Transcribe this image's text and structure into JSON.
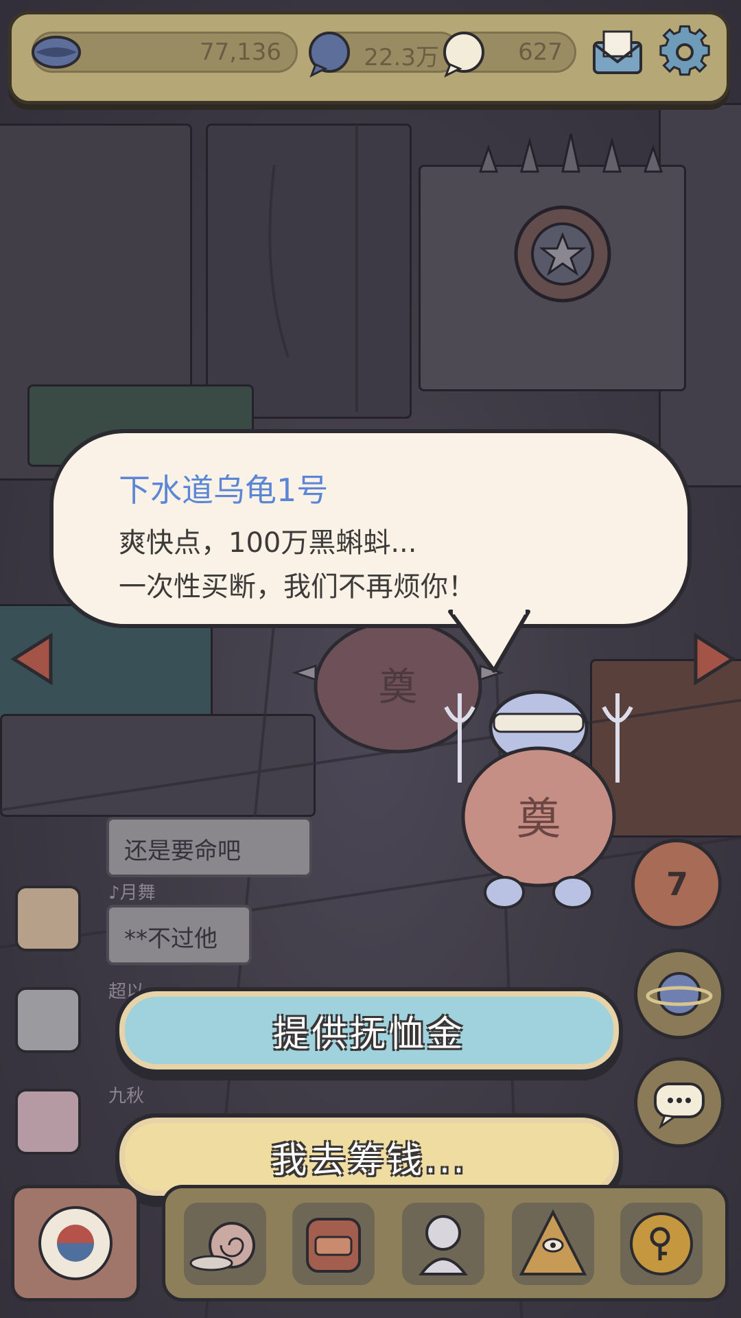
{
  "resources": {
    "coins": "77,136",
    "bubbles": "22.3万",
    "messages": "627"
  },
  "dialog": {
    "speaker": "下水道乌龟1号",
    "line1": "爽快点，100万黑蝌蚪...",
    "line2": "一次性买断，我们不再烦你！"
  },
  "chat": {
    "messages": [
      {
        "name": "",
        "text": "还是要命吧"
      },
      {
        "name": "♪月舞",
        "text": "**不过他"
      },
      {
        "name": "超以",
        "text": ""
      },
      {
        "name": "九秋",
        "text": ""
      }
    ]
  },
  "buttons": {
    "primary": "提供抚恤金",
    "secondary": "我去筹钱..."
  },
  "side": {
    "badge": "7"
  },
  "icons": {
    "coins": "lips-coin-icon",
    "bubbles": "speech-bubble-dark-icon",
    "messages": "speech-bubble-light-icon",
    "mail": "mail-icon",
    "settings": "gear-icon",
    "planet": "planet-icon",
    "chat": "chat-icon"
  },
  "colors": {
    "speaker": "#5b86d6",
    "primary_button": "#9fd2dc",
    "secondary_button": "#efdca1"
  }
}
